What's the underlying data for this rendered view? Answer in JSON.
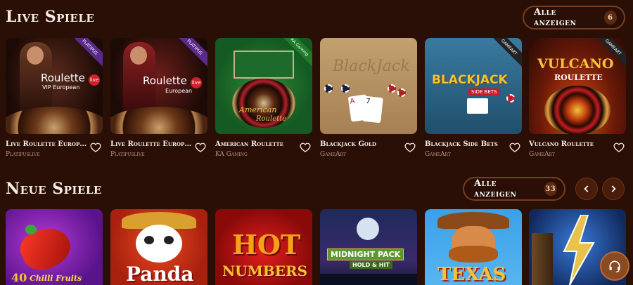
{
  "live": {
    "title": "Live Spiele",
    "show_all_label": "Alle anzeigen",
    "count": "6",
    "games": [
      {
        "title": "Live Roulette European...",
        "provider": "Platipuslive",
        "thumb_line1": "Roulette",
        "thumb_line2": "VIP European",
        "ribbon": "PLATIPUS"
      },
      {
        "title": "Live Roulette European",
        "provider": "Platipuslive",
        "thumb_line1": "Roulette",
        "thumb_line2": "European",
        "ribbon": "PLATIPUS"
      },
      {
        "title": "American Roulette",
        "provider": "KA Gaming",
        "thumb_line1": "American",
        "thumb_line2": "Roulette",
        "ribbon": "KA Gaming"
      },
      {
        "title": "Blackjack Gold",
        "provider": "GameArt",
        "thumb_line1": "BlackJack",
        "thumb_line2": "",
        "ribbon": ""
      },
      {
        "title": "Blackjack Side Bets",
        "provider": "GameArt",
        "thumb_line1": "BLACKJACK",
        "thumb_line2": "SIDE BETS",
        "ribbon": "GAMEART"
      },
      {
        "title": "Vulcano Roulette",
        "provider": "GameArt",
        "thumb_line1": "VULCANO",
        "thumb_line2": "ROULETTE",
        "ribbon": "GAMEART"
      }
    ]
  },
  "new": {
    "title": "Neue Spiele",
    "show_all_label": "Alle anzeigen",
    "count": "33",
    "prev_icon": "chevron-left-icon",
    "next_icon": "chevron-right-icon",
    "games": [
      {
        "thumb_line1": "40",
        "thumb_line2": "Chilli Fruits"
      },
      {
        "thumb_line1": "Panda",
        "thumb_line2": ""
      },
      {
        "thumb_line1": "HOT",
        "thumb_line2": "NUMBERS"
      },
      {
        "thumb_line1": "MIDNIGHT PACK",
        "thumb_line2": "HOLD & HIT"
      },
      {
        "thumb_line1": "TEXAS",
        "thumb_line2": ""
      },
      {
        "thumb_line1": "",
        "thumb_line2": ""
      }
    ]
  },
  "support": {
    "icon": "headset-icon"
  },
  "colors": {
    "background": "#2a0f06",
    "accent": "#7a3d1d",
    "support": "#8a4a22"
  }
}
